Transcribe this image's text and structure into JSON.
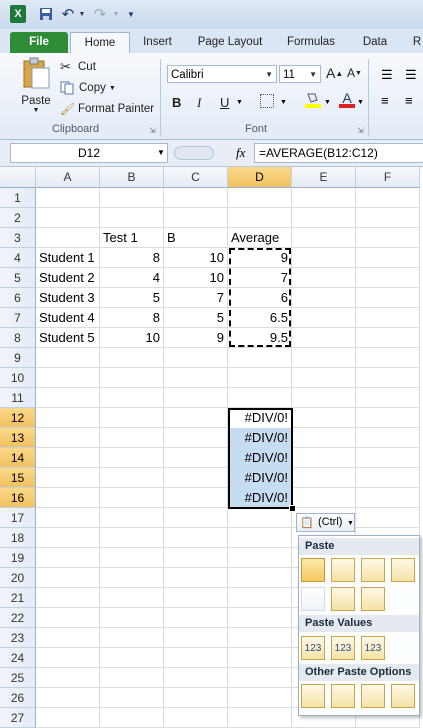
{
  "qat": {
    "excel_icon": "X",
    "save_icon": "save-icon",
    "undo": "↶",
    "redo": "↷"
  },
  "tabs": [
    "File",
    "Home",
    "Insert",
    "Page Layout",
    "Formulas",
    "Data",
    "R"
  ],
  "ribbon": {
    "paste": "Paste",
    "cut": "Cut",
    "copy": "Copy",
    "format_painter": "Format Painter",
    "clipboard_label": "Clipboard",
    "font_name": "Calibri",
    "font_size": "11",
    "font_label": "Font",
    "bold": "B",
    "italic": "I",
    "underline": "U"
  },
  "formula_bar": {
    "name_box": "D12",
    "fx": "fx",
    "formula": "=AVERAGE(B12:C12)"
  },
  "columns": [
    "A",
    "B",
    "C",
    "D",
    "E",
    "F"
  ],
  "rows": [
    "1",
    "2",
    "3",
    "4",
    "5",
    "6",
    "7",
    "8",
    "9",
    "10",
    "11",
    "12",
    "13",
    "14",
    "15",
    "16",
    "17",
    "18",
    "19",
    "20",
    "21",
    "22",
    "23",
    "24",
    "25",
    "26",
    "27"
  ],
  "sheet": {
    "header": {
      "b": "Test 1",
      "c": "B",
      "d": "Average"
    },
    "students": [
      {
        "name": "Student 1",
        "b": "8",
        "c": "10",
        "d": "9"
      },
      {
        "name": "Student 2",
        "b": "4",
        "c": "10",
        "d": "7"
      },
      {
        "name": "Student 3",
        "b": "5",
        "c": "7",
        "d": "6"
      },
      {
        "name": "Student 4",
        "b": "8",
        "c": "5",
        "d": "6.5"
      },
      {
        "name": "Student 5",
        "b": "10",
        "c": "9",
        "d": "9.5"
      }
    ],
    "errors": [
      "#DIV/0!",
      "#DIV/0!",
      "#DIV/0!",
      "#DIV/0!",
      "#DIV/0!"
    ]
  },
  "paste_popup": {
    "ctrl_label": "(Ctrl)",
    "paste_header": "Paste",
    "paste_values_header": "Paste Values",
    "other_header": "Other Paste Options",
    "icons_row1": [
      "paste-icon",
      "formulas-icon",
      "formulas-number-formatting-icon",
      "keep-source-formatting-icon"
    ],
    "icons_row2": [
      "no-borders-icon",
      "keep-column-widths-icon",
      "transpose-icon"
    ],
    "values_icons": [
      "values-icon",
      "values-number-formatting-icon",
      "values-source-formatting-icon"
    ],
    "other_icons": [
      "formatting-icon",
      "paste-link-icon",
      "picture-icon",
      "linked-picture-icon"
    ],
    "values_glyph": "123"
  },
  "colors": {
    "selected_header": "#f1c15f",
    "selection_fill": "#c6dcf0",
    "file_tab": "#2e8b36"
  }
}
